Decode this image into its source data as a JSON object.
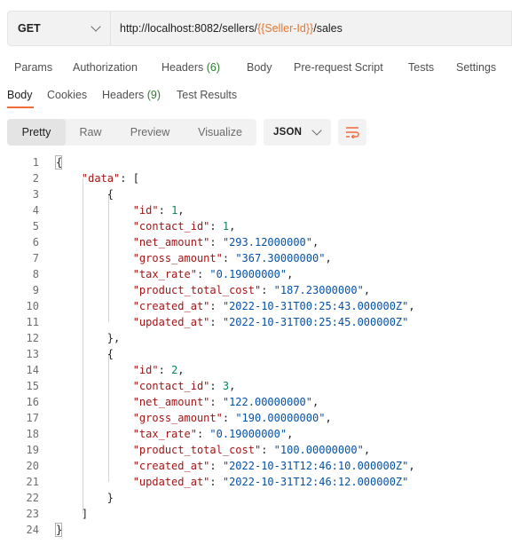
{
  "request": {
    "method": "GET",
    "url_prefix": "http://localhost:8082/sellers/",
    "url_var_open": "{{",
    "url_var": "Seller-Id",
    "url_var_close": "}}",
    "url_suffix": "/sales"
  },
  "request_tabs": [
    {
      "label": "Params"
    },
    {
      "label": "Authorization"
    },
    {
      "label": "Headers",
      "count": "(6)"
    },
    {
      "label": "Body"
    },
    {
      "label": "Pre-request Script"
    },
    {
      "label": "Tests"
    },
    {
      "label": "Settings"
    }
  ],
  "response_tabs": [
    {
      "label": "Body"
    },
    {
      "label": "Cookies"
    },
    {
      "label": "Headers",
      "count": "(9)"
    },
    {
      "label": "Test Results"
    }
  ],
  "view_modes": [
    "Pretty",
    "Raw",
    "Preview",
    "Visualize"
  ],
  "format": "JSON",
  "code_lines": [
    {
      "n": "1",
      "parts": [
        {
          "t": "{",
          "c": "p"
        }
      ]
    },
    {
      "n": "2",
      "parts": [
        {
          "t": "    ",
          "c": "p"
        },
        {
          "t": "\"data\"",
          "c": "key"
        },
        {
          "t": ": [",
          "c": "p"
        }
      ]
    },
    {
      "n": "3",
      "parts": [
        {
          "t": "        {",
          "c": "p"
        }
      ]
    },
    {
      "n": "4",
      "parts": [
        {
          "t": "            ",
          "c": "p"
        },
        {
          "t": "\"id\"",
          "c": "key"
        },
        {
          "t": ": ",
          "c": "p"
        },
        {
          "t": "1",
          "c": "num"
        },
        {
          "t": ",",
          "c": "p"
        }
      ]
    },
    {
      "n": "5",
      "parts": [
        {
          "t": "            ",
          "c": "p"
        },
        {
          "t": "\"contact_id\"",
          "c": "key"
        },
        {
          "t": ": ",
          "c": "p"
        },
        {
          "t": "1",
          "c": "num"
        },
        {
          "t": ",",
          "c": "p"
        }
      ]
    },
    {
      "n": "6",
      "parts": [
        {
          "t": "            ",
          "c": "p"
        },
        {
          "t": "\"net_amount\"",
          "c": "key"
        },
        {
          "t": ": ",
          "c": "p"
        },
        {
          "t": "\"293.12000000\"",
          "c": "str"
        },
        {
          "t": ",",
          "c": "p"
        }
      ]
    },
    {
      "n": "7",
      "parts": [
        {
          "t": "            ",
          "c": "p"
        },
        {
          "t": "\"gross_amount\"",
          "c": "key"
        },
        {
          "t": ": ",
          "c": "p"
        },
        {
          "t": "\"367.30000000\"",
          "c": "str"
        },
        {
          "t": ",",
          "c": "p"
        }
      ]
    },
    {
      "n": "8",
      "parts": [
        {
          "t": "            ",
          "c": "p"
        },
        {
          "t": "\"tax_rate\"",
          "c": "key"
        },
        {
          "t": ": ",
          "c": "p"
        },
        {
          "t": "\"0.19000000\"",
          "c": "str"
        },
        {
          "t": ",",
          "c": "p"
        }
      ]
    },
    {
      "n": "9",
      "parts": [
        {
          "t": "            ",
          "c": "p"
        },
        {
          "t": "\"product_total_cost\"",
          "c": "key"
        },
        {
          "t": ": ",
          "c": "p"
        },
        {
          "t": "\"187.23000000\"",
          "c": "str"
        },
        {
          "t": ",",
          "c": "p"
        }
      ]
    },
    {
      "n": "10",
      "parts": [
        {
          "t": "            ",
          "c": "p"
        },
        {
          "t": "\"created_at\"",
          "c": "key"
        },
        {
          "t": ": ",
          "c": "p"
        },
        {
          "t": "\"2022-10-31T00:25:43.000000Z\"",
          "c": "str"
        },
        {
          "t": ",",
          "c": "p"
        }
      ]
    },
    {
      "n": "11",
      "parts": [
        {
          "t": "            ",
          "c": "p"
        },
        {
          "t": "\"updated_at\"",
          "c": "key"
        },
        {
          "t": ": ",
          "c": "p"
        },
        {
          "t": "\"2022-10-31T00:25:45.000000Z\"",
          "c": "str"
        }
      ]
    },
    {
      "n": "12",
      "parts": [
        {
          "t": "        },",
          "c": "p"
        }
      ]
    },
    {
      "n": "13",
      "parts": [
        {
          "t": "        {",
          "c": "p"
        }
      ]
    },
    {
      "n": "14",
      "parts": [
        {
          "t": "            ",
          "c": "p"
        },
        {
          "t": "\"id\"",
          "c": "key"
        },
        {
          "t": ": ",
          "c": "p"
        },
        {
          "t": "2",
          "c": "num"
        },
        {
          "t": ",",
          "c": "p"
        }
      ]
    },
    {
      "n": "15",
      "parts": [
        {
          "t": "            ",
          "c": "p"
        },
        {
          "t": "\"contact_id\"",
          "c": "key"
        },
        {
          "t": ": ",
          "c": "p"
        },
        {
          "t": "3",
          "c": "num"
        },
        {
          "t": ",",
          "c": "p"
        }
      ]
    },
    {
      "n": "16",
      "parts": [
        {
          "t": "            ",
          "c": "p"
        },
        {
          "t": "\"net_amount\"",
          "c": "key"
        },
        {
          "t": ": ",
          "c": "p"
        },
        {
          "t": "\"122.00000000\"",
          "c": "str"
        },
        {
          "t": ",",
          "c": "p"
        }
      ]
    },
    {
      "n": "17",
      "parts": [
        {
          "t": "            ",
          "c": "p"
        },
        {
          "t": "\"gross_amount\"",
          "c": "key"
        },
        {
          "t": ": ",
          "c": "p"
        },
        {
          "t": "\"190.00000000\"",
          "c": "str"
        },
        {
          "t": ",",
          "c": "p"
        }
      ]
    },
    {
      "n": "18",
      "parts": [
        {
          "t": "            ",
          "c": "p"
        },
        {
          "t": "\"tax_rate\"",
          "c": "key"
        },
        {
          "t": ": ",
          "c": "p"
        },
        {
          "t": "\"0.19000000\"",
          "c": "str"
        },
        {
          "t": ",",
          "c": "p"
        }
      ]
    },
    {
      "n": "19",
      "parts": [
        {
          "t": "            ",
          "c": "p"
        },
        {
          "t": "\"product_total_cost\"",
          "c": "key"
        },
        {
          "t": ": ",
          "c": "p"
        },
        {
          "t": "\"100.00000000\"",
          "c": "str"
        },
        {
          "t": ",",
          "c": "p"
        }
      ]
    },
    {
      "n": "20",
      "parts": [
        {
          "t": "            ",
          "c": "p"
        },
        {
          "t": "\"created_at\"",
          "c": "key"
        },
        {
          "t": ": ",
          "c": "p"
        },
        {
          "t": "\"2022-10-31T12:46:10.000000Z\"",
          "c": "str"
        },
        {
          "t": ",",
          "c": "p"
        }
      ]
    },
    {
      "n": "21",
      "parts": [
        {
          "t": "            ",
          "c": "p"
        },
        {
          "t": "\"updated_at\"",
          "c": "key"
        },
        {
          "t": ": ",
          "c": "p"
        },
        {
          "t": "\"2022-10-31T12:46:12.000000Z\"",
          "c": "str"
        }
      ]
    },
    {
      "n": "22",
      "parts": [
        {
          "t": "        }",
          "c": "p"
        }
      ]
    },
    {
      "n": "23",
      "parts": [
        {
          "t": "    ]",
          "c": "p"
        }
      ]
    },
    {
      "n": "24",
      "parts": [
        {
          "t": "}",
          "c": "p"
        }
      ]
    }
  ]
}
